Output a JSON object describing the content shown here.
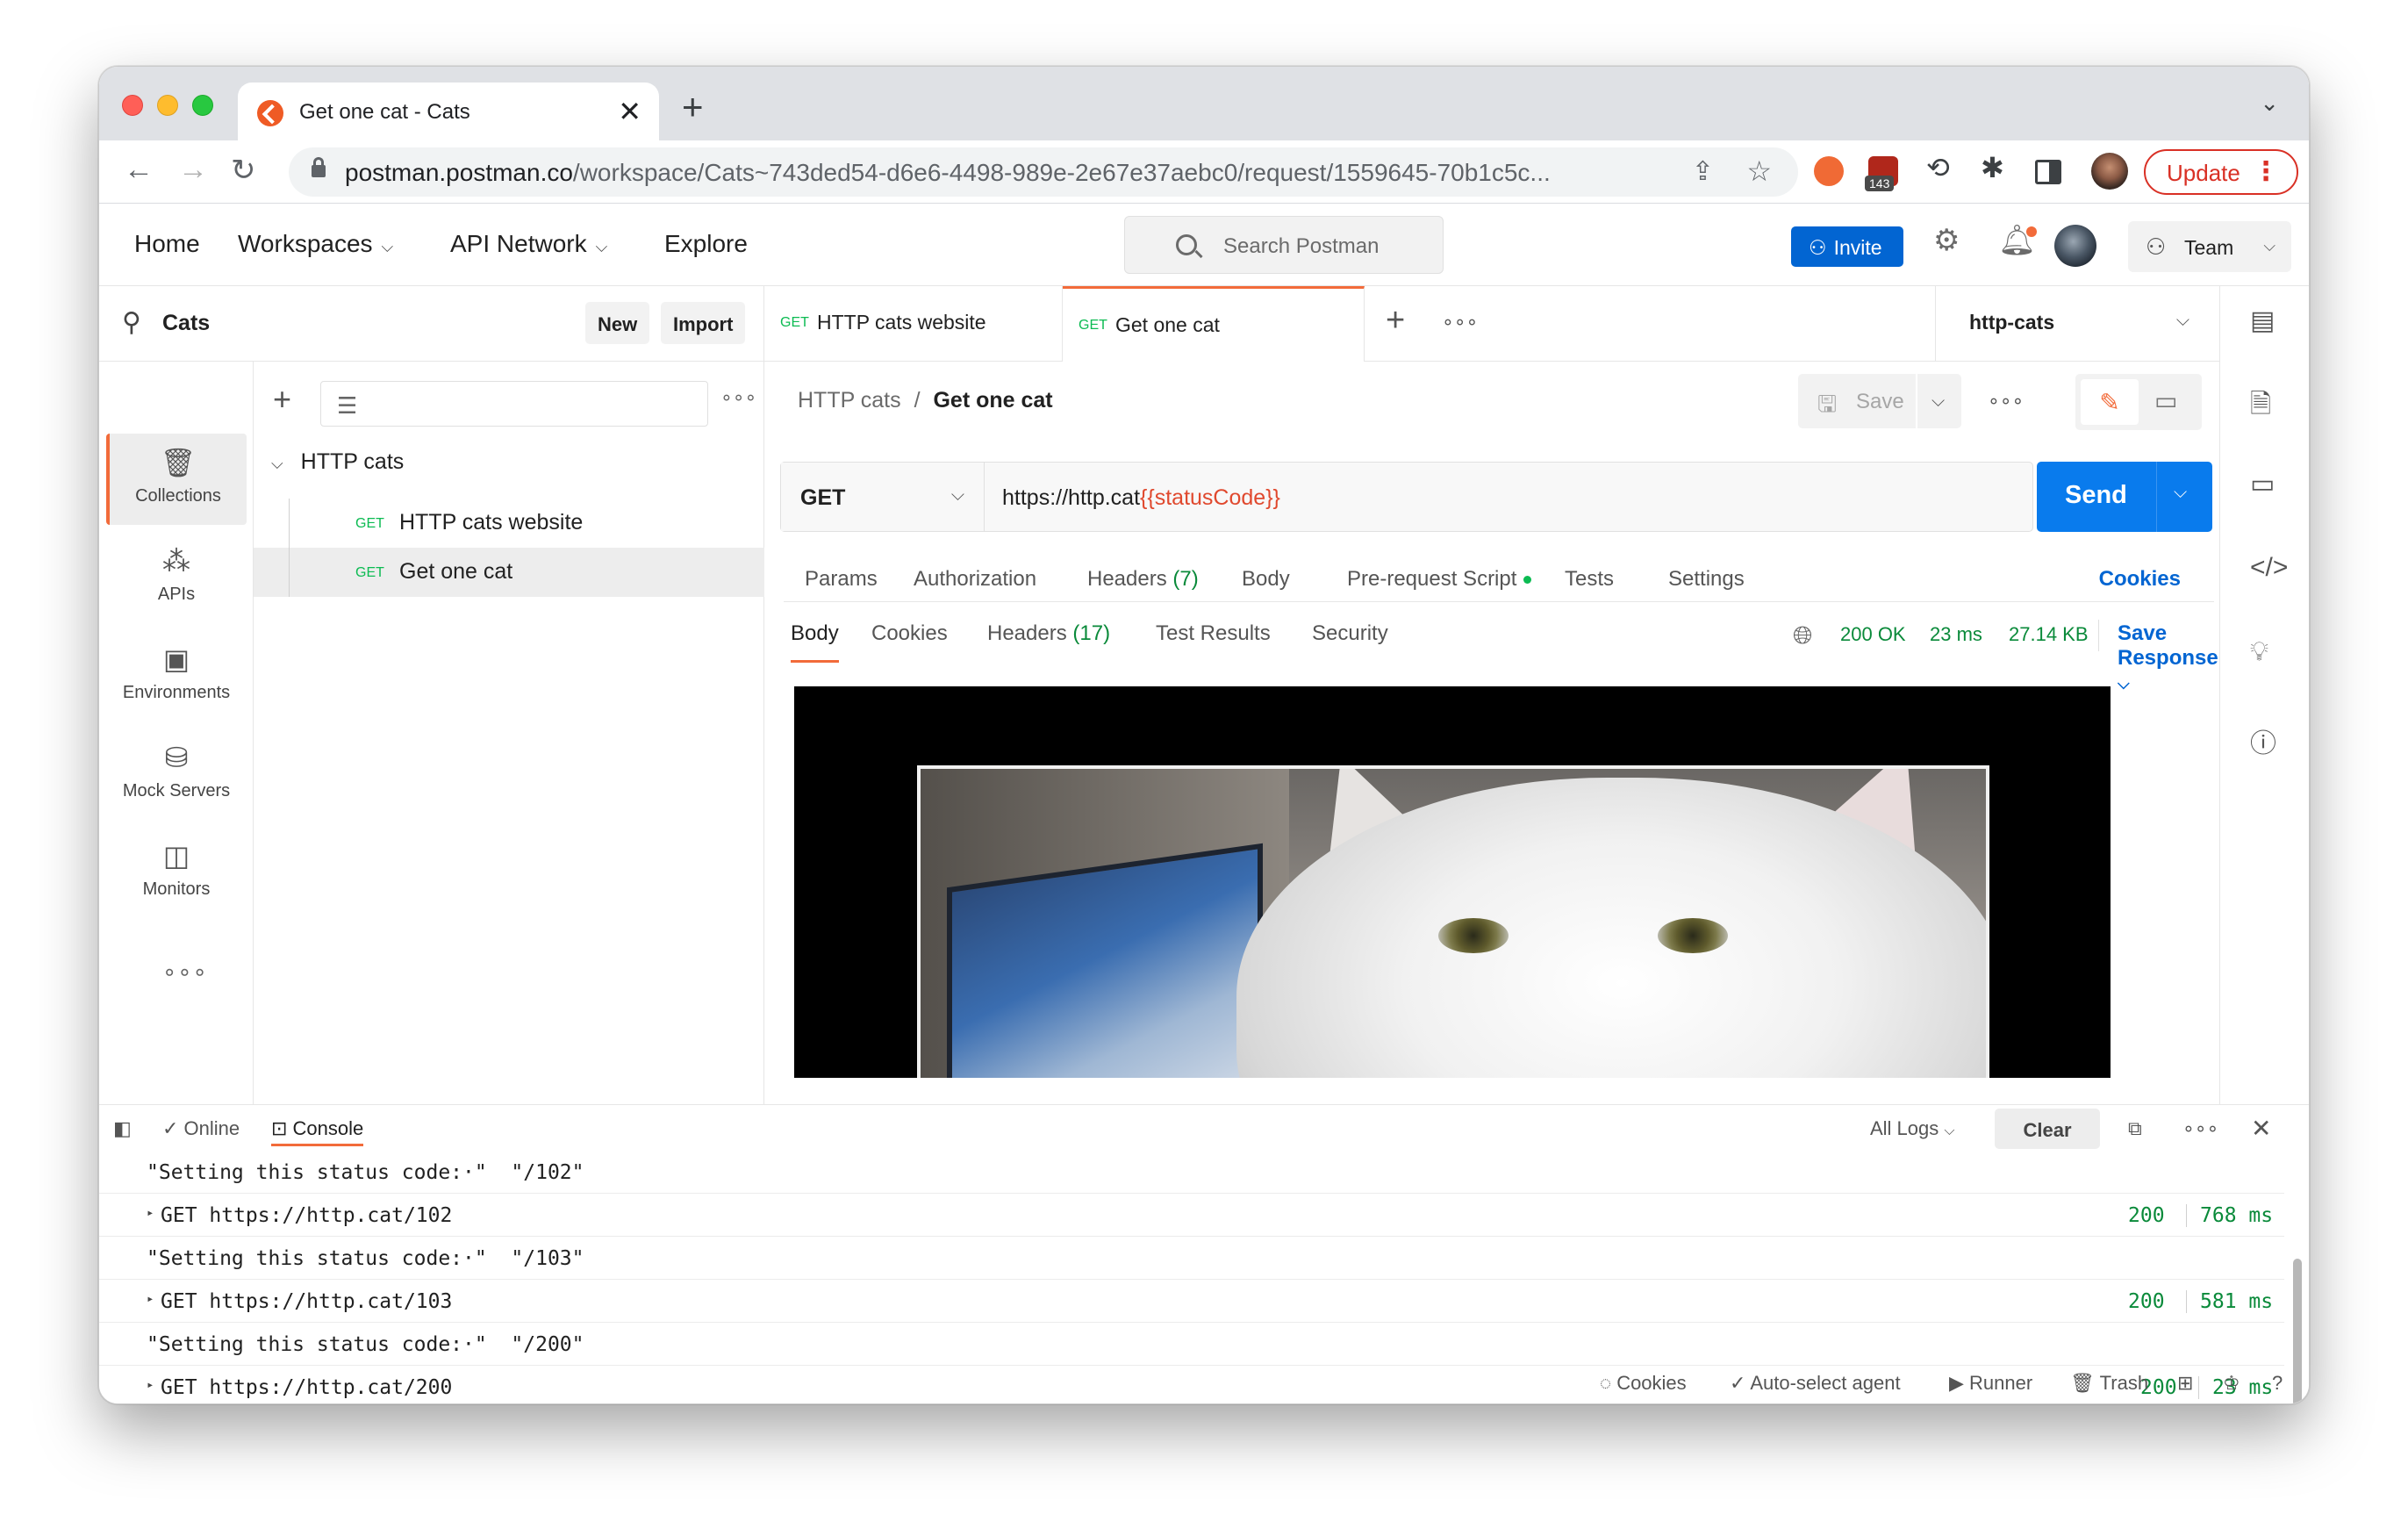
{
  "browser": {
    "tab_title": "Get one cat - Cats",
    "new_tab_glyph": "+",
    "close_glyph": "✕",
    "url_host": "postman.postman.co",
    "url_path": "/workspace/Cats~743ded54-d6e6-4498-989e-2e67e37aebc0/request/1559645-70b1c5c...",
    "extension_badge": "143",
    "update_label": "Update"
  },
  "header": {
    "nav": [
      "Home",
      "Workspaces",
      "API Network",
      "Explore"
    ],
    "search_placeholder": "Search Postman",
    "invite_label": "Invite",
    "team_label": "Team"
  },
  "workspace": {
    "name": "Cats",
    "new_label": "New",
    "import_label": "Import"
  },
  "rail": {
    "items": [
      {
        "label": "Collections",
        "icon": "collections-icon"
      },
      {
        "label": "APIs",
        "icon": "apis-icon"
      },
      {
        "label": "Environments",
        "icon": "environments-icon"
      },
      {
        "label": "Mock Servers",
        "icon": "mock-servers-icon"
      },
      {
        "label": "Monitors",
        "icon": "monitors-icon"
      }
    ]
  },
  "sidebar": {
    "folder": "HTTP cats",
    "requests": [
      {
        "method": "GET",
        "name": "HTTP cats website"
      },
      {
        "method": "GET",
        "name": "Get one cat"
      }
    ]
  },
  "tabs": {
    "open": [
      {
        "method": "GET",
        "name": "HTTP cats website"
      },
      {
        "method": "GET",
        "name": "Get one cat"
      }
    ],
    "environment": "http-cats"
  },
  "request": {
    "breadcrumb_parent": "HTTP cats",
    "breadcrumb_sep": "/",
    "breadcrumb_current": "Get one cat",
    "save_label": "Save",
    "method": "GET",
    "url_base": "https://http.cat",
    "url_var": "{{statusCode}}",
    "send_label": "Send",
    "subtabs": {
      "params": "Params",
      "authorization": "Authorization",
      "headers": "Headers",
      "headers_count": "(7)",
      "body": "Body",
      "prerequest": "Pre-request Script",
      "tests": "Tests",
      "settings": "Settings",
      "cookies": "Cookies"
    }
  },
  "response": {
    "tabs": {
      "body": "Body",
      "cookies": "Cookies",
      "headers": "Headers",
      "headers_count": "(17)",
      "test_results": "Test Results",
      "security": "Security"
    },
    "status": "200 OK",
    "time": "23 ms",
    "size": "27.14 KB",
    "save_response": "Save Response"
  },
  "console": {
    "online_label": "Online",
    "console_label": "Console",
    "all_logs": "All Logs",
    "clear_label": "Clear",
    "lines": [
      {
        "kind": "log",
        "text": "\"Setting this status code:·\"  \"/102\""
      },
      {
        "kind": "req",
        "text": "GET https://http.cat/102",
        "code": "200",
        "time": "768 ms"
      },
      {
        "kind": "log",
        "text": "\"Setting this status code:·\"  \"/103\""
      },
      {
        "kind": "req",
        "text": "GET https://http.cat/103",
        "code": "200",
        "time": "581 ms"
      },
      {
        "kind": "log",
        "text": "\"Setting this status code:·\"  \"/200\""
      },
      {
        "kind": "req",
        "text": "GET https://http.cat/200",
        "code": "200",
        "time": "23 ms"
      }
    ]
  },
  "statusbar": {
    "cookies": "Cookies",
    "agent": "Auto-select agent",
    "runner": "Runner",
    "trash": "Trash"
  },
  "colors": {
    "accent": "#f26b3a",
    "primary": "#097bed",
    "success": "#0a8a3a",
    "variable": "#e0492e"
  }
}
